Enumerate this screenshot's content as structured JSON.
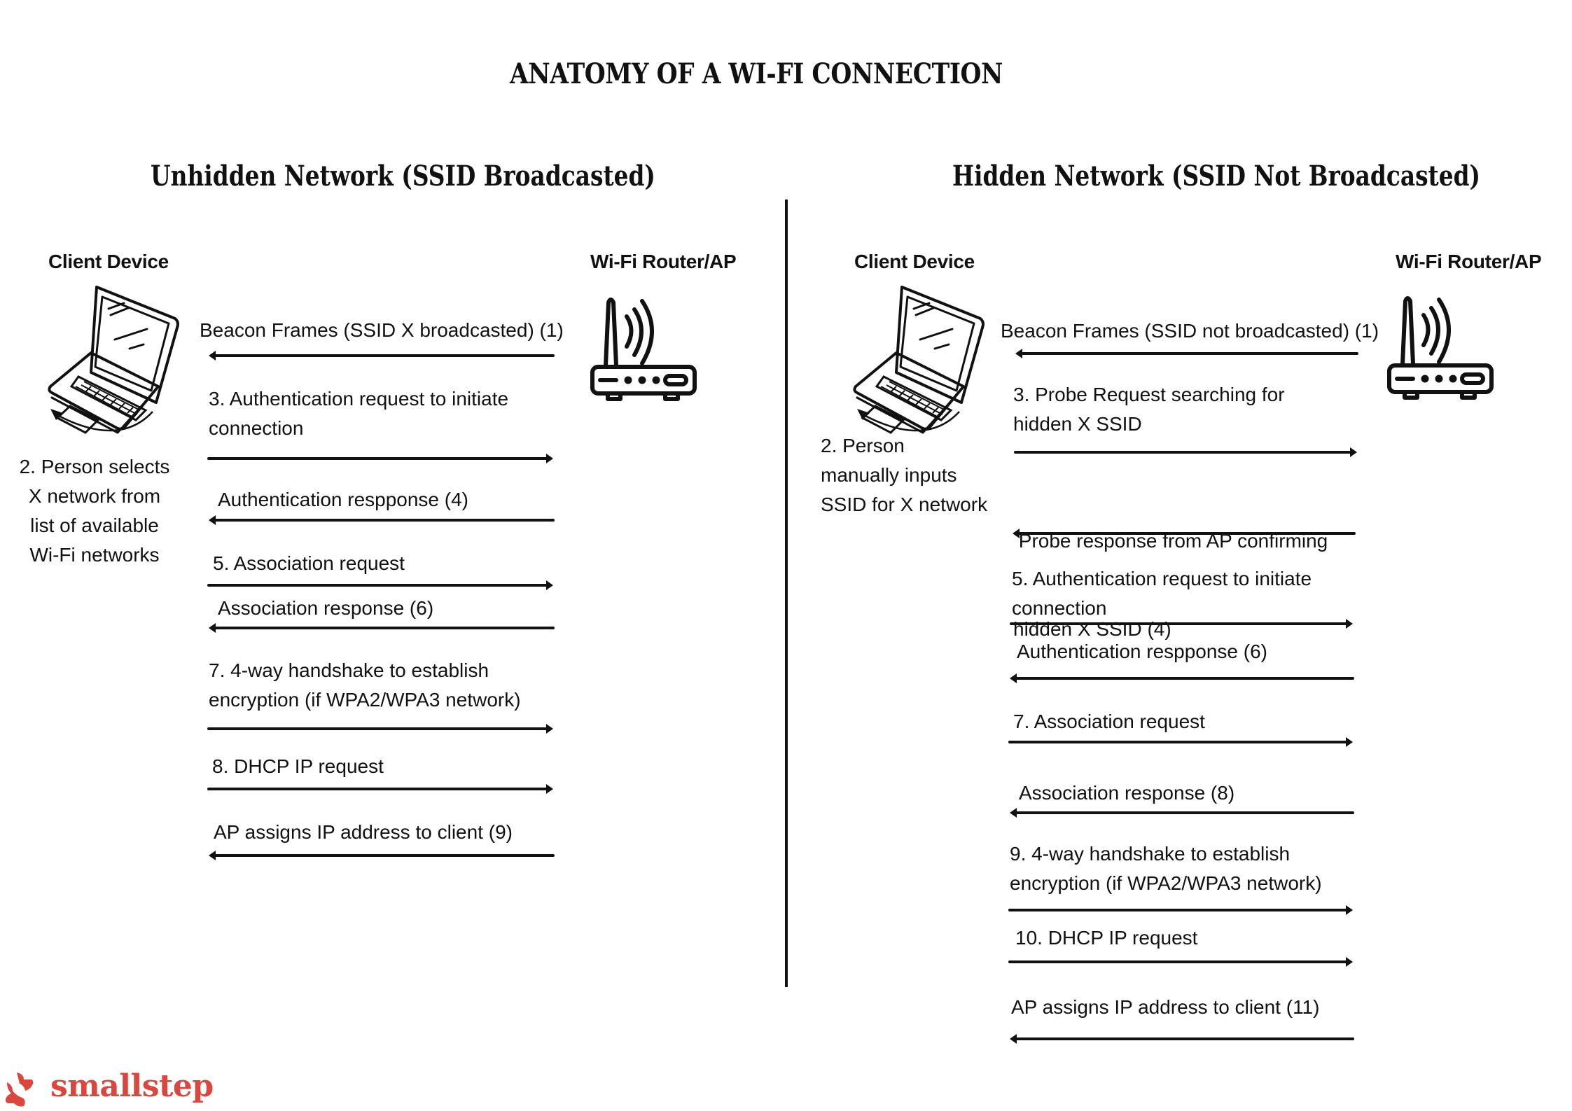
{
  "title": "ANATOMY OF A WI-FI CONNECTION",
  "brand": {
    "name": "smallstep",
    "color": "#d9473f",
    "icon": "smallstep-logo-icon"
  },
  "panels": {
    "unhidden": {
      "title": "Unhidden Network (SSID Broadcasted)",
      "client_label": "Client Device",
      "router_label": "Wi-Fi Router/AP",
      "client_icon": "laptop-icon",
      "router_icon": "wifi-router-icon",
      "client_note": [
        "2. Person selects",
        "X network from",
        "list of available",
        "Wi-Fi networks"
      ],
      "messages": [
        {
          "lines": [
            "Beacon Frames (SSID X broadcasted) (1)"
          ],
          "direction": "to-client"
        },
        {
          "lines": [
            "3. Authentication request to initiate",
            "connection"
          ],
          "direction": "to-router"
        },
        {
          "lines": [
            "Authentication respponse (4)"
          ],
          "direction": "to-client"
        },
        {
          "lines": [
            "5. Association request"
          ],
          "direction": "to-router"
        },
        {
          "lines": [
            "Association response (6)"
          ],
          "direction": "to-client"
        },
        {
          "lines": [
            "7. 4-way handshake to establish",
            "encryption (if WPA2/WPA3 network)"
          ],
          "direction": "to-router"
        },
        {
          "lines": [
            "8. DHCP IP request"
          ],
          "direction": "to-router"
        },
        {
          "lines": [
            "AP assigns IP address to client (9)"
          ],
          "direction": "to-client"
        }
      ]
    },
    "hidden": {
      "title": "Hidden Network (SSID Not Broadcasted)",
      "client_label": "Client Device",
      "router_label": "Wi-Fi Router/AP",
      "client_icon": "laptop-icon",
      "router_icon": "wifi-router-icon",
      "client_note": [
        "2. Person",
        "manually inputs",
        "SSID for X network"
      ],
      "messages": [
        {
          "lines": [
            "Beacon Frames (SSID not broadcasted) (1)"
          ],
          "direction": "to-client"
        },
        {
          "lines": [
            "3. Probe Request searching for",
            "hidden X SSID"
          ],
          "direction": "to-router"
        },
        {
          "lines": [
            " Probe response from AP confirming",
            "hidden X SSID (4)"
          ],
          "direction": "to-client"
        },
        {
          "lines": [
            "5. Authentication request to initiate",
            "connection"
          ],
          "direction": "to-router"
        },
        {
          "lines": [
            "Authentication respponse (6)"
          ],
          "direction": "to-client"
        },
        {
          "lines": [
            "7. Association request"
          ],
          "direction": "to-router"
        },
        {
          "lines": [
            "Association response (8)"
          ],
          "direction": "to-client"
        },
        {
          "lines": [
            "9. 4-way handshake to establish",
            "encryption (if WPA2/WPA3 network)"
          ],
          "direction": "to-router"
        },
        {
          "lines": [
            "10. DHCP IP request"
          ],
          "direction": "to-router"
        },
        {
          "lines": [
            "AP assigns IP address to client (11)"
          ],
          "direction": "to-client"
        }
      ]
    }
  }
}
